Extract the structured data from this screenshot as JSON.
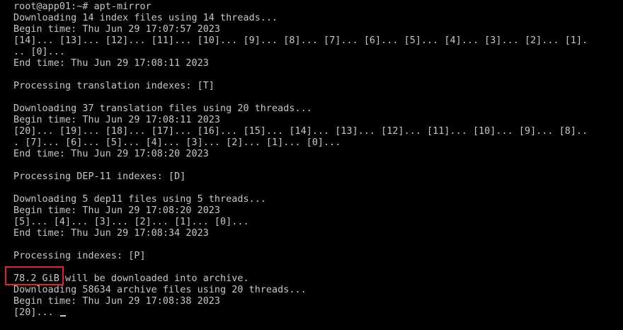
{
  "terminal": {
    "lines": [
      "root@app01:~# apt-mirror",
      "Downloading 14 index files using 14 threads...",
      "Begin time: Thu Jun 29 17:07:57 2023",
      "[14]... [13]... [12]... [11]... [10]... [9]... [8]... [7]... [6]... [5]... [4]... [3]... [2]... [1].",
      ".. [0]...",
      "End time: Thu Jun 29 17:08:11 2023",
      "",
      "Processing translation indexes: [T]",
      "",
      "Downloading 37 translation files using 20 threads...",
      "Begin time: Thu Jun 29 17:08:11 2023",
      "[20]... [19]... [18]... [17]... [16]... [15]... [14]... [13]... [12]... [11]... [10]... [9]... [8]..",
      ". [7]... [6]... [5]... [4]... [3]... [2]... [1]... [0]...",
      "End time: Thu Jun 29 17:08:20 2023",
      "",
      "Processing DEP-11 indexes: [D]",
      "",
      "Downloading 5 dep11 files using 5 threads...",
      "Begin time: Thu Jun 29 17:08:20 2023",
      "[5]... [4]... [3]... [2]... [1]... [0]...",
      "End time: Thu Jun 29 17:08:34 2023",
      "",
      "Processing indexes: [P]",
      "",
      "78.2 GiB will be downloaded into archive.",
      "Downloading 58634 archive files using 20 threads...",
      "Begin time: Thu Jun 29 17:08:38 2023",
      "[20]... "
    ]
  },
  "annotation": {
    "highlighted_text": "78.2 GiB",
    "box_color": "#e0232a"
  }
}
